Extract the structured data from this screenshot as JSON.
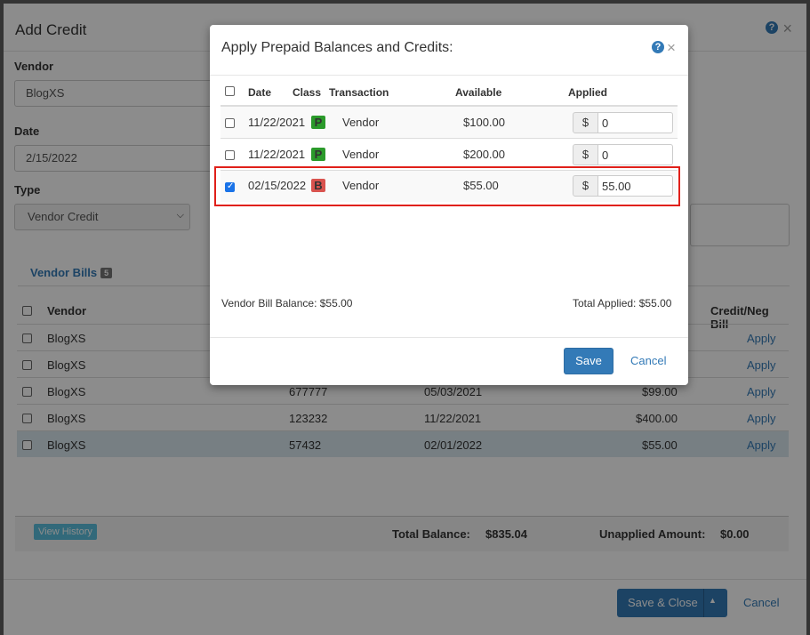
{
  "background": {
    "title": "Add Credit",
    "help_icon": "?",
    "close_icon": "×",
    "vendor_label": "Vendor",
    "vendor_value": "BlogXS",
    "date_label": "Date",
    "date_value": "2/15/2022",
    "type_label": "Type",
    "type_value": "Vendor Credit",
    "tab_label": "Vendor Bills",
    "tab_count": "5",
    "bills_headers": {
      "vendor": "Vendor",
      "credit": "Credit/Neg Bill"
    },
    "bills_rows": [
      {
        "vendor": "BlogXS",
        "number": "",
        "date": "",
        "amount": "",
        "action": "Apply"
      },
      {
        "vendor": "BlogXS",
        "number": "",
        "date": "",
        "amount": "",
        "action": "Apply"
      },
      {
        "vendor": "BlogXS",
        "number": "677777",
        "date": "05/03/2021",
        "amount": "$99.00",
        "action": "Apply"
      },
      {
        "vendor": "BlogXS",
        "number": "123232",
        "date": "11/22/2021",
        "amount": "$400.00",
        "action": "Apply"
      },
      {
        "vendor": "BlogXS",
        "number": "57432",
        "date": "02/01/2022",
        "amount": "$55.00",
        "action": "Apply"
      }
    ],
    "view_history": "View History",
    "total_balance_label": "Total Balance:",
    "total_balance_value": "$835.04",
    "unapplied_label": "Unapplied Amount:",
    "unapplied_value": "$0.00",
    "save_close": "Save & Close",
    "cancel": "Cancel"
  },
  "modal": {
    "title": "Apply Prepaid Balances and Credits:",
    "help_icon": "?",
    "close_icon": "×",
    "headers": {
      "date": "Date",
      "class": "Class",
      "transaction": "Transaction",
      "available": "Available",
      "applied": "Applied"
    },
    "rows": [
      {
        "checked": false,
        "date": "11/22/2021",
        "class": "P",
        "transaction": "Vendor",
        "available": "$100.00",
        "currency": "$",
        "applied": "0"
      },
      {
        "checked": false,
        "date": "11/22/2021",
        "class": "P",
        "transaction": "Vendor",
        "available": "$200.00",
        "currency": "$",
        "applied": "0"
      },
      {
        "checked": true,
        "date": "02/15/2022",
        "class": "B",
        "transaction": "Vendor",
        "available": "$55.00",
        "currency": "$",
        "applied": "55.00"
      }
    ],
    "vendor_bill_balance": "Vendor Bill Balance: $55.00",
    "total_applied": "Total Applied: $55.00",
    "save": "Save",
    "cancel": "Cancel"
  },
  "colors": {
    "accent": "#337ab7",
    "class_p": "#2b9a2b",
    "class_b": "#d9534f",
    "highlight": "#e0201a"
  }
}
